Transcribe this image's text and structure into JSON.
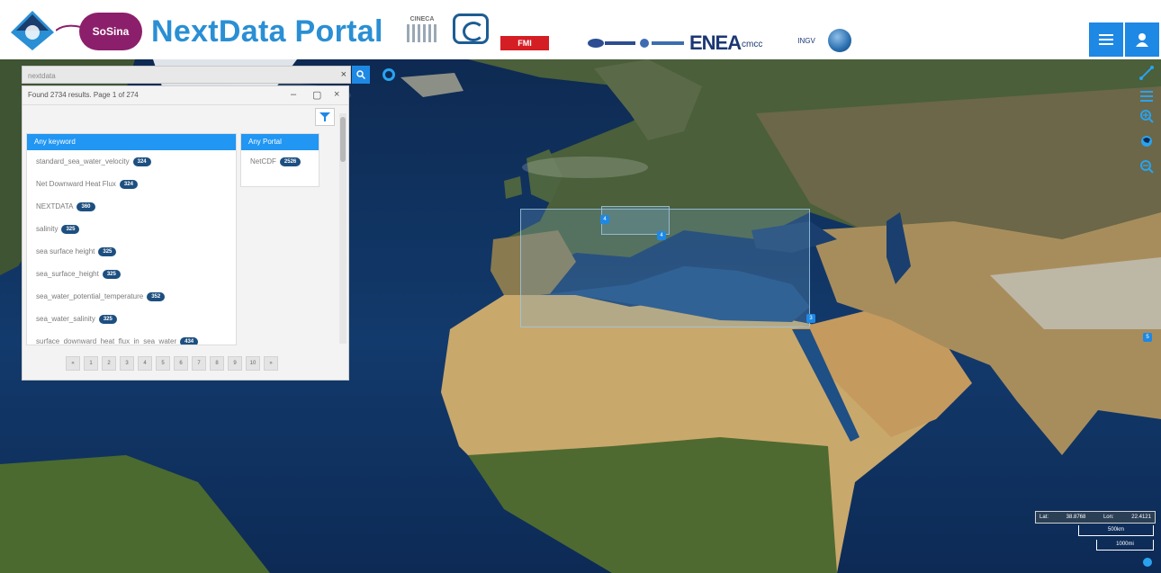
{
  "header": {
    "sosina_label": "SoSina",
    "portal_title": "NextData Portal",
    "partners": {
      "cineca": "CINECA",
      "red_logo": "FMI",
      "enea": "ENEA",
      "cmcc": "cmcc",
      "ingv": "INGV"
    }
  },
  "search": {
    "value": "nextdata"
  },
  "panel": {
    "results_text": "Found 2734 results. Page 1 of 274",
    "keywords_header": "Any keyword",
    "portals_header": "Any Portal",
    "keywords": [
      {
        "label": "standard_sea_water_velocity",
        "count": "324"
      },
      {
        "label": "Net Downward Heat Flux",
        "count": "324"
      },
      {
        "label": "NEXTDATA",
        "count": "360"
      },
      {
        "label": "salinity",
        "count": "325"
      },
      {
        "label": "sea surface height",
        "count": "325"
      },
      {
        "label": "sea_surface_height",
        "count": "325"
      },
      {
        "label": "sea_water_potential_temperature",
        "count": "352"
      },
      {
        "label": "sea_water_salinity",
        "count": "325"
      },
      {
        "label": "surface_downward_heat_flux_in_sea_water",
        "count": "434"
      }
    ],
    "portals": [
      {
        "label": "NetCDF",
        "count": "2526"
      }
    ],
    "pages": [
      "«",
      "1",
      "2",
      "3",
      "4",
      "5",
      "6",
      "7",
      "8",
      "9",
      "10",
      "»"
    ]
  },
  "map": {
    "markers": [
      "4",
      "4",
      "3",
      "5"
    ],
    "coords": {
      "lat_label": "Lat:",
      "lat": "38.8768",
      "lon_label": "Lon:",
      "lon": "22.4121"
    },
    "scale_top": "500km",
    "scale_bottom": "1000mi"
  },
  "colors": {
    "accent": "#1e88e5",
    "title": "#2a8fd4",
    "badge": "#1d4f80",
    "ocean": "#123a6c"
  }
}
